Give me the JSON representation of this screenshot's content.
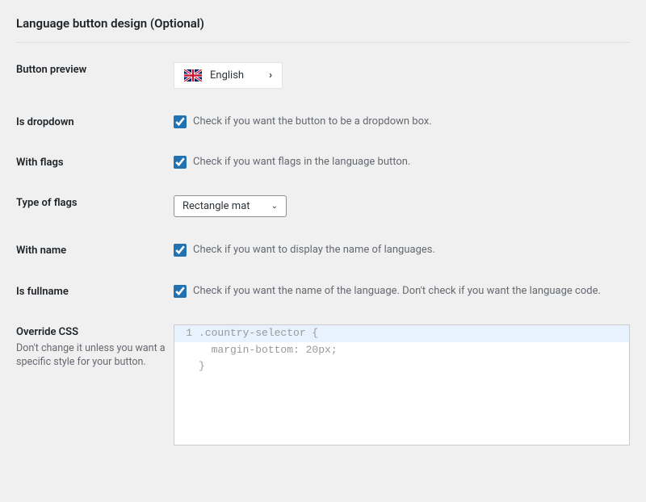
{
  "section_title": "Language button design (Optional)",
  "preview": {
    "label": "Button preview",
    "language": "English"
  },
  "is_dropdown": {
    "label": "Is dropdown",
    "desc": "Check if you want the button to be a dropdown box."
  },
  "with_flags": {
    "label": "With flags",
    "desc": "Check if you want flags in the language button."
  },
  "type_flags": {
    "label": "Type of flags",
    "value": "Rectangle mat"
  },
  "with_name": {
    "label": "With name",
    "desc": "Check if you want to display the name of languages."
  },
  "is_fullname": {
    "label": "Is fullname",
    "desc": "Check if you want the name of the language. Don't check if you want the language code."
  },
  "override_css": {
    "label": "Override CSS",
    "sublabel": "Don't change it unless you want a specific style for your button.",
    "line1_num": "1",
    "line1": ".country-selector {",
    "line2": "  margin-bottom: 20px;",
    "line3": "}"
  }
}
